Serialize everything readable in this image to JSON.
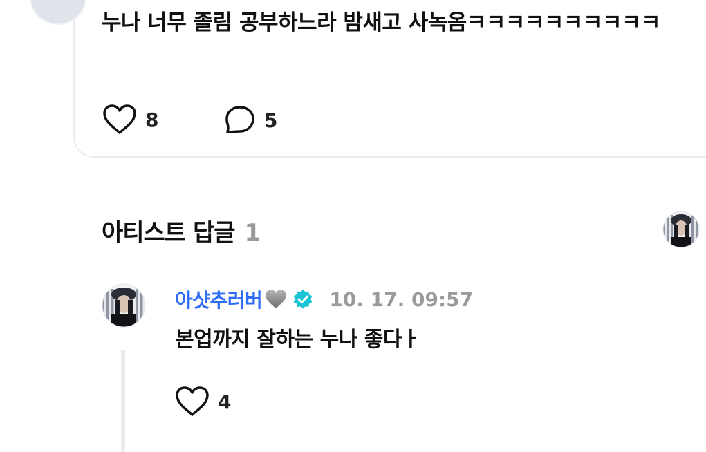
{
  "post": {
    "text": "누나 너무 졸림 공부하느라 밤새고 사녹옴ㅋㅋㅋㅋㅋㅋㅋㅋㅋㅋ",
    "like_count": "8",
    "comment_count": "5"
  },
  "artist_replies": {
    "title": "아티스트 답글",
    "count": "1"
  },
  "reply": {
    "author": "아샷추러버",
    "timestamp": "10. 17. 09:57",
    "text": "본업까지 잘하는 누나 좋다ㅏ",
    "like_count": "4"
  },
  "icons": {
    "like": "heart-outline-icon",
    "comment": "speech-bubble-icon",
    "verified": "verified-badge-icon",
    "emoji": "grey-heart-emoji"
  },
  "colors": {
    "author_link": "#2f6df6",
    "verified_badge": "#1bc4d4",
    "muted_text": "#9a9a9a",
    "card_border": "#ececf0"
  }
}
